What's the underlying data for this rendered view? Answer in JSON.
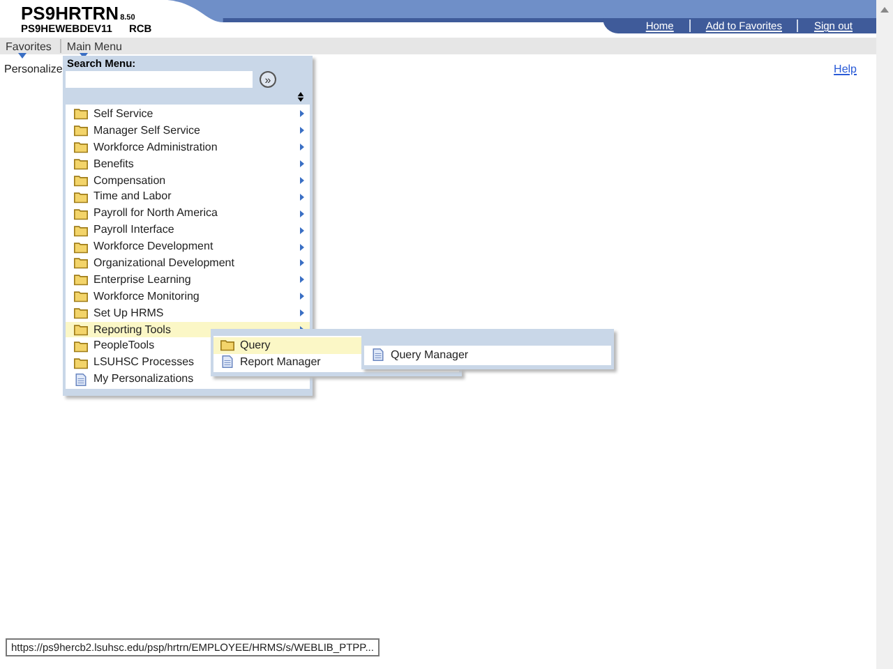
{
  "header": {
    "system": "PS9HRTRN",
    "version": "8.50",
    "database": "PS9HEWEBDEV11",
    "user": "RCB"
  },
  "nav_links": [
    "Home",
    "Add to Favorites",
    "Sign out"
  ],
  "menu_bar": [
    {
      "label": "Favorites"
    },
    {
      "label": "Main Menu"
    }
  ],
  "page": {
    "title": "Personalize",
    "help": "Help"
  },
  "main_menu": {
    "search_label": "Search Menu:",
    "go": "»",
    "items": [
      {
        "label": "Self Service",
        "kind": "folder",
        "selected": false
      },
      {
        "label": "Manager Self Service",
        "kind": "folder",
        "selected": false
      },
      {
        "label": "Workforce Administration",
        "kind": "folder",
        "selected": false
      },
      {
        "label": "Benefits",
        "kind": "folder",
        "selected": false
      },
      {
        "label": "Compensation",
        "kind": "folder",
        "selected": false
      },
      {
        "label": "Time and Labor",
        "kind": "folder",
        "selected": false
      },
      {
        "label": "Payroll for North America",
        "kind": "folder",
        "selected": false
      },
      {
        "label": "Payroll Interface",
        "kind": "folder",
        "selected": false
      },
      {
        "label": "Workforce Development",
        "kind": "folder",
        "selected": false
      },
      {
        "label": "Organizational Development",
        "kind": "folder",
        "selected": false
      },
      {
        "label": "Enterprise Learning",
        "kind": "folder",
        "selected": false
      },
      {
        "label": "Workforce Monitoring",
        "kind": "folder",
        "selected": false
      },
      {
        "label": "Set Up HRMS",
        "kind": "folder",
        "selected": false
      },
      {
        "label": "Reporting Tools",
        "kind": "folder",
        "selected": true,
        "children": [
          {
            "label": "Query",
            "kind": "folder",
            "selected": true,
            "children": [
              {
                "label": "Query Manager",
                "kind": "page",
                "selected": false
              }
            ]
          },
          {
            "label": "Report Manager",
            "kind": "page",
            "selected": false
          }
        ]
      },
      {
        "label": "PeopleTools",
        "kind": "folder",
        "selected": false
      },
      {
        "label": "LSUHSC Processes",
        "kind": "folder",
        "selected": false
      },
      {
        "label": "My Personalizations",
        "kind": "page",
        "selected": false
      }
    ]
  },
  "status_url": "https://ps9hercb2.lsuhsc.edu/psp/hrtrn/EMPLOYEE/HRMS/s/WEBLIB_PTPP..."
}
